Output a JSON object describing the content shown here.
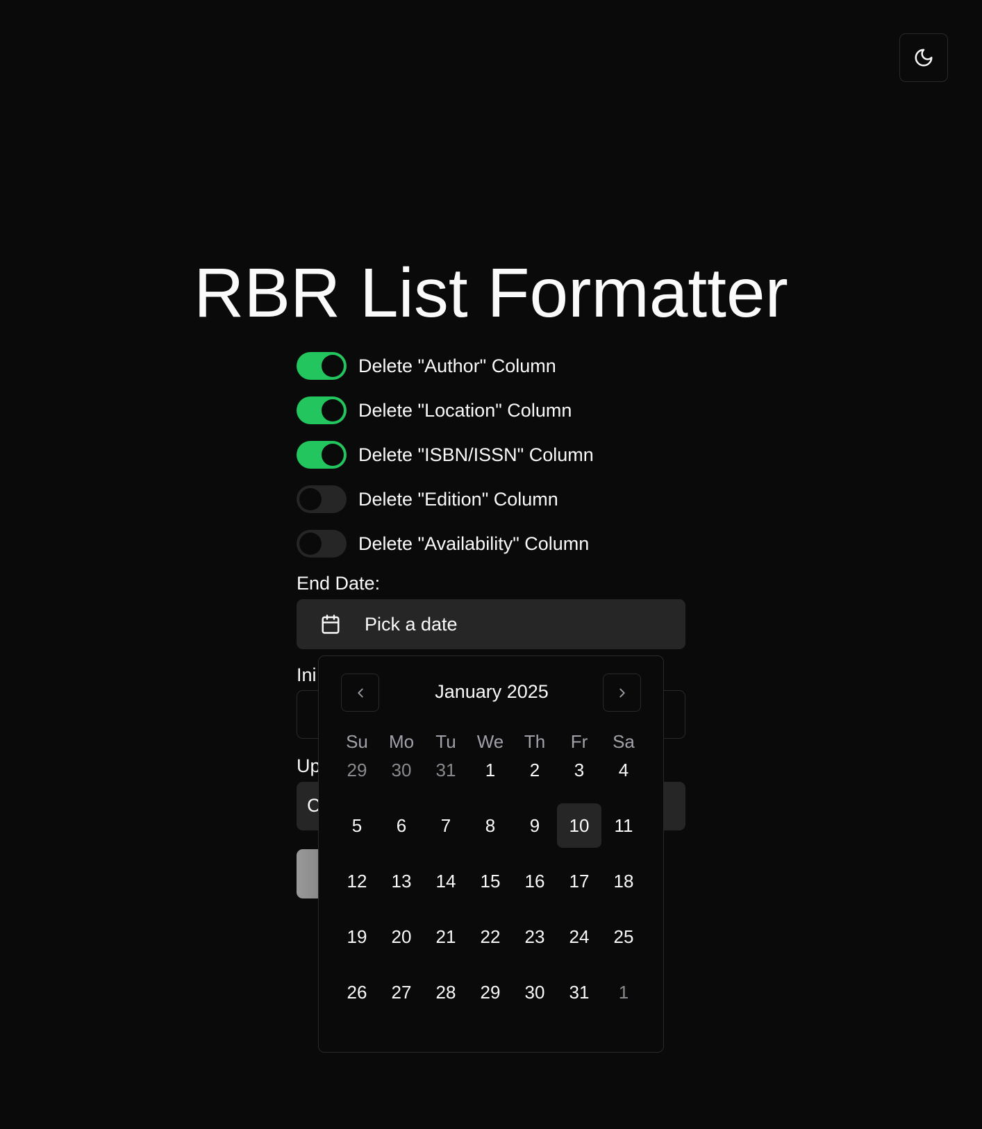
{
  "title": "RBR List Formatter",
  "theme_toggle": {
    "icon": "moon-icon"
  },
  "toggles": [
    {
      "label": "Delete \"Author\" Column",
      "on": true
    },
    {
      "label": "Delete \"Location\" Column",
      "on": true
    },
    {
      "label": "Delete \"ISBN/ISSN\" Column",
      "on": true
    },
    {
      "label": "Delete \"Edition\" Column",
      "on": false
    },
    {
      "label": "Delete \"Availability\" Column",
      "on": false
    }
  ],
  "end_date": {
    "label": "End Date:",
    "placeholder": "Pick a date"
  },
  "partial": {
    "label_a": "Ini",
    "label_b": "Up",
    "field_text": "C"
  },
  "calendar": {
    "month_label": "January 2025",
    "weekdays": [
      "Su",
      "Mo",
      "Tu",
      "We",
      "Th",
      "Fr",
      "Sa"
    ],
    "weeks": [
      [
        {
          "d": "29",
          "out": true
        },
        {
          "d": "30",
          "out": true
        },
        {
          "d": "31",
          "out": true
        },
        {
          "d": "1"
        },
        {
          "d": "2"
        },
        {
          "d": "3"
        },
        {
          "d": "4"
        }
      ],
      [
        {
          "d": "5"
        },
        {
          "d": "6"
        },
        {
          "d": "7"
        },
        {
          "d": "8"
        },
        {
          "d": "9"
        },
        {
          "d": "10",
          "selected": true
        },
        {
          "d": "11"
        }
      ],
      [
        {
          "d": "12"
        },
        {
          "d": "13"
        },
        {
          "d": "14"
        },
        {
          "d": "15"
        },
        {
          "d": "16"
        },
        {
          "d": "17"
        },
        {
          "d": "18"
        }
      ],
      [
        {
          "d": "19"
        },
        {
          "d": "20"
        },
        {
          "d": "21"
        },
        {
          "d": "22"
        },
        {
          "d": "23"
        },
        {
          "d": "24"
        },
        {
          "d": "25"
        }
      ],
      [
        {
          "d": "26"
        },
        {
          "d": "27"
        },
        {
          "d": "28"
        },
        {
          "d": "29"
        },
        {
          "d": "30"
        },
        {
          "d": "31"
        },
        {
          "d": "1",
          "out": true
        }
      ]
    ]
  },
  "colors": {
    "accent": "#22c55e",
    "background": "#0a0a0a",
    "muted": "#262626"
  }
}
